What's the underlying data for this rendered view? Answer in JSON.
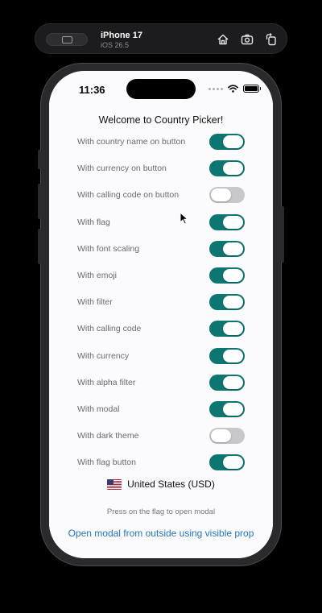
{
  "simulator": {
    "device_name": "iPhone 17",
    "os_version": "iOS 26.5",
    "icons": [
      "home-icon",
      "screenshot-icon",
      "rotate-icon"
    ]
  },
  "status_bar": {
    "time": "11:36"
  },
  "app": {
    "title": "Welcome to Country Picker!",
    "options": [
      {
        "label": "With country name on button",
        "on": true
      },
      {
        "label": "With currency on button",
        "on": true
      },
      {
        "label": "With calling code on button",
        "on": false
      },
      {
        "label": "With flag",
        "on": true
      },
      {
        "label": "With font scaling",
        "on": true
      },
      {
        "label": "With emoji",
        "on": true
      },
      {
        "label": "With filter",
        "on": true
      },
      {
        "label": "With calling code",
        "on": true
      },
      {
        "label": "With currency",
        "on": true
      },
      {
        "label": "With alpha filter",
        "on": true
      },
      {
        "label": "With modal",
        "on": true
      },
      {
        "label": "With dark theme",
        "on": false
      },
      {
        "label": "With flag button",
        "on": true
      }
    ],
    "selected_country": "United States (USD)",
    "hint": "Press on the flag to open modal",
    "open_modal_link": "Open modal from outside using visible prop"
  },
  "colors": {
    "switch_on": "#0e7671",
    "switch_off": "#c8c8cc",
    "link": "#2176c8"
  }
}
